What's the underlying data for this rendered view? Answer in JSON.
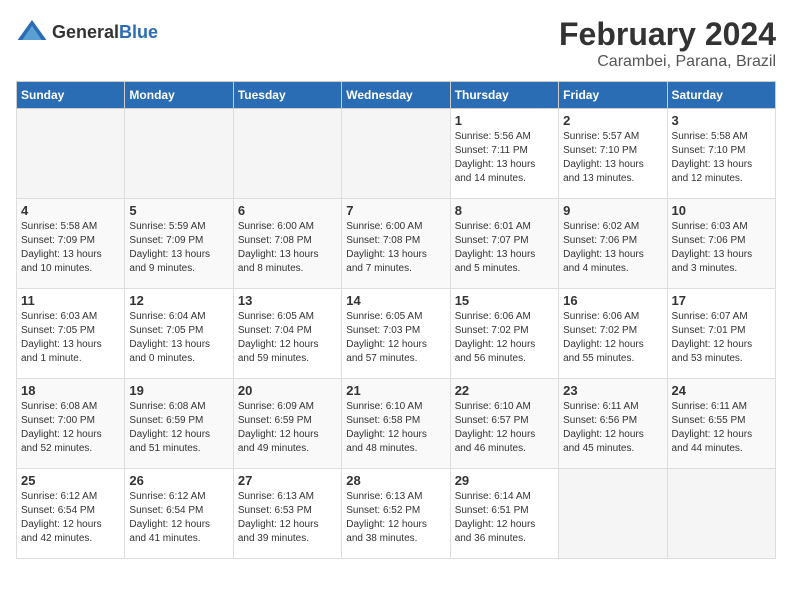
{
  "logo": {
    "general": "General",
    "blue": "Blue"
  },
  "header": {
    "title": "February 2024",
    "subtitle": "Carambei, Parana, Brazil"
  },
  "weekdays": [
    "Sunday",
    "Monday",
    "Tuesday",
    "Wednesday",
    "Thursday",
    "Friday",
    "Saturday"
  ],
  "weeks": [
    [
      {
        "day": "",
        "info": ""
      },
      {
        "day": "",
        "info": ""
      },
      {
        "day": "",
        "info": ""
      },
      {
        "day": "",
        "info": ""
      },
      {
        "day": "1",
        "info": "Sunrise: 5:56 AM\nSunset: 7:11 PM\nDaylight: 13 hours\nand 14 minutes."
      },
      {
        "day": "2",
        "info": "Sunrise: 5:57 AM\nSunset: 7:10 PM\nDaylight: 13 hours\nand 13 minutes."
      },
      {
        "day": "3",
        "info": "Sunrise: 5:58 AM\nSunset: 7:10 PM\nDaylight: 13 hours\nand 12 minutes."
      }
    ],
    [
      {
        "day": "4",
        "info": "Sunrise: 5:58 AM\nSunset: 7:09 PM\nDaylight: 13 hours\nand 10 minutes."
      },
      {
        "day": "5",
        "info": "Sunrise: 5:59 AM\nSunset: 7:09 PM\nDaylight: 13 hours\nand 9 minutes."
      },
      {
        "day": "6",
        "info": "Sunrise: 6:00 AM\nSunset: 7:08 PM\nDaylight: 13 hours\nand 8 minutes."
      },
      {
        "day": "7",
        "info": "Sunrise: 6:00 AM\nSunset: 7:08 PM\nDaylight: 13 hours\nand 7 minutes."
      },
      {
        "day": "8",
        "info": "Sunrise: 6:01 AM\nSunset: 7:07 PM\nDaylight: 13 hours\nand 5 minutes."
      },
      {
        "day": "9",
        "info": "Sunrise: 6:02 AM\nSunset: 7:06 PM\nDaylight: 13 hours\nand 4 minutes."
      },
      {
        "day": "10",
        "info": "Sunrise: 6:03 AM\nSunset: 7:06 PM\nDaylight: 13 hours\nand 3 minutes."
      }
    ],
    [
      {
        "day": "11",
        "info": "Sunrise: 6:03 AM\nSunset: 7:05 PM\nDaylight: 13 hours\nand 1 minute."
      },
      {
        "day": "12",
        "info": "Sunrise: 6:04 AM\nSunset: 7:05 PM\nDaylight: 13 hours\nand 0 minutes."
      },
      {
        "day": "13",
        "info": "Sunrise: 6:05 AM\nSunset: 7:04 PM\nDaylight: 12 hours\nand 59 minutes."
      },
      {
        "day": "14",
        "info": "Sunrise: 6:05 AM\nSunset: 7:03 PM\nDaylight: 12 hours\nand 57 minutes."
      },
      {
        "day": "15",
        "info": "Sunrise: 6:06 AM\nSunset: 7:02 PM\nDaylight: 12 hours\nand 56 minutes."
      },
      {
        "day": "16",
        "info": "Sunrise: 6:06 AM\nSunset: 7:02 PM\nDaylight: 12 hours\nand 55 minutes."
      },
      {
        "day": "17",
        "info": "Sunrise: 6:07 AM\nSunset: 7:01 PM\nDaylight: 12 hours\nand 53 minutes."
      }
    ],
    [
      {
        "day": "18",
        "info": "Sunrise: 6:08 AM\nSunset: 7:00 PM\nDaylight: 12 hours\nand 52 minutes."
      },
      {
        "day": "19",
        "info": "Sunrise: 6:08 AM\nSunset: 6:59 PM\nDaylight: 12 hours\nand 51 minutes."
      },
      {
        "day": "20",
        "info": "Sunrise: 6:09 AM\nSunset: 6:59 PM\nDaylight: 12 hours\nand 49 minutes."
      },
      {
        "day": "21",
        "info": "Sunrise: 6:10 AM\nSunset: 6:58 PM\nDaylight: 12 hours\nand 48 minutes."
      },
      {
        "day": "22",
        "info": "Sunrise: 6:10 AM\nSunset: 6:57 PM\nDaylight: 12 hours\nand 46 minutes."
      },
      {
        "day": "23",
        "info": "Sunrise: 6:11 AM\nSunset: 6:56 PM\nDaylight: 12 hours\nand 45 minutes."
      },
      {
        "day": "24",
        "info": "Sunrise: 6:11 AM\nSunset: 6:55 PM\nDaylight: 12 hours\nand 44 minutes."
      }
    ],
    [
      {
        "day": "25",
        "info": "Sunrise: 6:12 AM\nSunset: 6:54 PM\nDaylight: 12 hours\nand 42 minutes."
      },
      {
        "day": "26",
        "info": "Sunrise: 6:12 AM\nSunset: 6:54 PM\nDaylight: 12 hours\nand 41 minutes."
      },
      {
        "day": "27",
        "info": "Sunrise: 6:13 AM\nSunset: 6:53 PM\nDaylight: 12 hours\nand 39 minutes."
      },
      {
        "day": "28",
        "info": "Sunrise: 6:13 AM\nSunset: 6:52 PM\nDaylight: 12 hours\nand 38 minutes."
      },
      {
        "day": "29",
        "info": "Sunrise: 6:14 AM\nSunset: 6:51 PM\nDaylight: 12 hours\nand 36 minutes."
      },
      {
        "day": "",
        "info": ""
      },
      {
        "day": "",
        "info": ""
      }
    ]
  ]
}
